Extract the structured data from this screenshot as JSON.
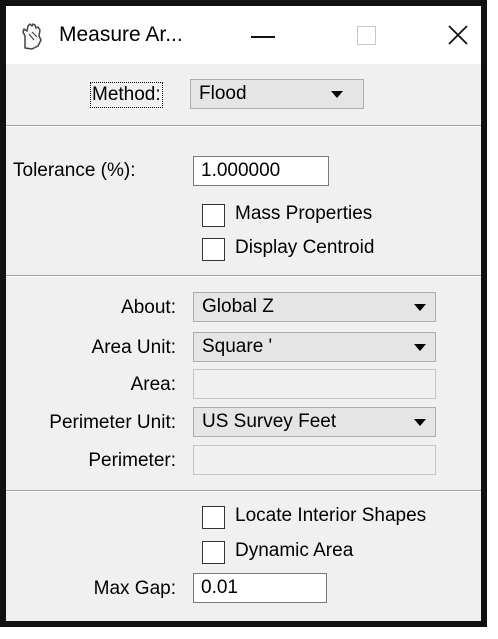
{
  "window": {
    "title": "Measure Ar...",
    "app_icon": "hand-measure-icon"
  },
  "titlebar_buttons": [
    "minimize-icon",
    "maximize-icon",
    "close-icon"
  ],
  "method": {
    "label": "Method:",
    "value": "Flood"
  },
  "tolerance": {
    "label": "Tolerance (%):",
    "value": "1.000000"
  },
  "checkboxes_top": [
    {
      "label": "Mass Properties",
      "checked": false
    },
    {
      "label": "Display Centroid",
      "checked": false
    }
  ],
  "about": {
    "label": "About:",
    "value": "Global Z"
  },
  "area_unit": {
    "label": "Area Unit:",
    "value": "Square '"
  },
  "area": {
    "label": "Area:",
    "value": ""
  },
  "perimeter_unit": {
    "label": "Perimeter Unit:",
    "value": "US Survey Feet"
  },
  "perimeter": {
    "label": "Perimeter:",
    "value": ""
  },
  "checkboxes_bottom": [
    {
      "label": "Locate Interior Shapes",
      "checked": false
    },
    {
      "label": "Dynamic Area",
      "checked": false
    }
  ],
  "max_gap": {
    "label": "Max Gap:",
    "value": "0.01"
  }
}
